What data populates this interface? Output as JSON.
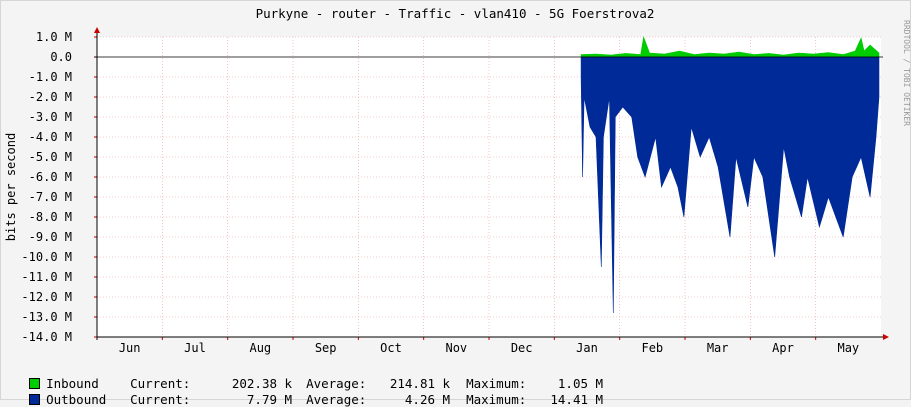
{
  "chart_data": {
    "type": "area",
    "title": "Purkyne - router  - Traffic - vlan410 - 5G Foerstrova2",
    "ylabel": "bits per second",
    "credit": "RRDTOOL / TOBI OETIKER",
    "ylim": [
      -14.0,
      1.0
    ],
    "yticks": [
      {
        "v": 1.0,
        "label": "1.0 M"
      },
      {
        "v": 0.0,
        "label": "0.0"
      },
      {
        "v": -1.0,
        "label": "-1.0 M"
      },
      {
        "v": -2.0,
        "label": "-2.0 M"
      },
      {
        "v": -3.0,
        "label": "-3.0 M"
      },
      {
        "v": -4.0,
        "label": "-4.0 M"
      },
      {
        "v": -5.0,
        "label": "-5.0 M"
      },
      {
        "v": -6.0,
        "label": "-6.0 M"
      },
      {
        "v": -7.0,
        "label": "-7.0 M"
      },
      {
        "v": -8.0,
        "label": "-8.0 M"
      },
      {
        "v": -9.0,
        "label": "-9.0 M"
      },
      {
        "v": -10.0,
        "label": "-10.0 M"
      },
      {
        "v": -11.0,
        "label": "-11.0 M"
      },
      {
        "v": -12.0,
        "label": "-12.0 M"
      },
      {
        "v": -13.0,
        "label": "-13.0 M"
      },
      {
        "v": -14.0,
        "label": "-14.0 M"
      }
    ],
    "months": [
      "Jun",
      "Jul",
      "Aug",
      "Sep",
      "Oct",
      "Nov",
      "Dec",
      "Jan",
      "Feb",
      "Mar",
      "Apr",
      "May"
    ],
    "grid": true,
    "series": [
      {
        "name": "Inbound",
        "color": "#00cc00",
        "data": [
          [
            0.0,
            0.12
          ],
          [
            0.05,
            0.15
          ],
          [
            0.1,
            0.1
          ],
          [
            0.15,
            0.18
          ],
          [
            0.2,
            0.12
          ],
          [
            0.21,
            1.0
          ],
          [
            0.23,
            0.2
          ],
          [
            0.28,
            0.15
          ],
          [
            0.33,
            0.3
          ],
          [
            0.38,
            0.12
          ],
          [
            0.43,
            0.2
          ],
          [
            0.48,
            0.15
          ],
          [
            0.53,
            0.25
          ],
          [
            0.58,
            0.12
          ],
          [
            0.63,
            0.18
          ],
          [
            0.68,
            0.1
          ],
          [
            0.73,
            0.2
          ],
          [
            0.78,
            0.15
          ],
          [
            0.83,
            0.22
          ],
          [
            0.88,
            0.12
          ],
          [
            0.92,
            0.3
          ],
          [
            0.94,
            0.95
          ],
          [
            0.95,
            0.3
          ],
          [
            0.97,
            0.6
          ],
          [
            1.0,
            0.2
          ]
        ]
      },
      {
        "name": "Outbound",
        "color": "#002a97",
        "data": [
          [
            0.0,
            -1.0
          ],
          [
            0.005,
            -6.0
          ],
          [
            0.01,
            -2.0
          ],
          [
            0.03,
            -3.5
          ],
          [
            0.05,
            -4.0
          ],
          [
            0.068,
            -10.5
          ],
          [
            0.075,
            -4.0
          ],
          [
            0.095,
            -2.0
          ],
          [
            0.108,
            -12.8
          ],
          [
            0.115,
            -3.0
          ],
          [
            0.14,
            -2.5
          ],
          [
            0.17,
            -3.0
          ],
          [
            0.19,
            -5.0
          ],
          [
            0.215,
            -6.0
          ],
          [
            0.25,
            -4.0
          ],
          [
            0.27,
            -6.5
          ],
          [
            0.3,
            -5.5
          ],
          [
            0.325,
            -6.5
          ],
          [
            0.345,
            -8.0
          ],
          [
            0.37,
            -3.5
          ],
          [
            0.4,
            -5.0
          ],
          [
            0.43,
            -4.0
          ],
          [
            0.46,
            -5.5
          ],
          [
            0.5,
            -9.0
          ],
          [
            0.52,
            -5.0
          ],
          [
            0.56,
            -7.5
          ],
          [
            0.58,
            -5.0
          ],
          [
            0.61,
            -6.0
          ],
          [
            0.65,
            -10.0
          ],
          [
            0.68,
            -4.5
          ],
          [
            0.7,
            -6.0
          ],
          [
            0.74,
            -8.0
          ],
          [
            0.76,
            -6.0
          ],
          [
            0.8,
            -8.5
          ],
          [
            0.83,
            -7.0
          ],
          [
            0.88,
            -9.0
          ],
          [
            0.91,
            -6.0
          ],
          [
            0.94,
            -5.0
          ],
          [
            0.97,
            -7.0
          ],
          [
            0.99,
            -4.0
          ],
          [
            1.0,
            -2.0
          ]
        ]
      }
    ],
    "data_start_month_fraction": 0.62
  },
  "legend": [
    {
      "name": "Inbound",
      "color": "#00cc00",
      "current_label": "Current:",
      "current": "202.38 k",
      "average_label": "Average:",
      "average": "214.81 k",
      "maximum_label": "Maximum:",
      "maximum": "1.05 M"
    },
    {
      "name": "Outbound",
      "color": "#002a97",
      "current_label": "Current:",
      "current": "7.79 M",
      "average_label": "Average:",
      "average": "4.26 M",
      "maximum_label": "Maximum:",
      "maximum": "14.41 M"
    }
  ]
}
